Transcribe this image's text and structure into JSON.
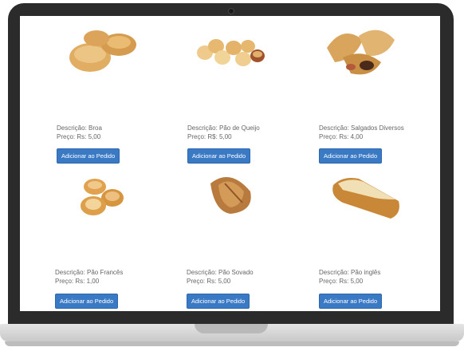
{
  "products": [
    {
      "description": "Descrição: Broa",
      "price": "Preço: Rs: 5,00",
      "button": "Adicionar ao Pedido"
    },
    {
      "description": "Descrição: Pão de Queijo",
      "price": "Preço: R$: 5,00",
      "button": "Adicionar ao Pedido"
    },
    {
      "description": "Descrição: Salgados Diversos",
      "price": "Preço: Rs: 4,00",
      "button": "Adicionar ao Pedido"
    },
    {
      "description": "Descrição: Pão Francês",
      "price": "Preço: Rs: 1,00",
      "button": "Adicionar ao Pedido"
    },
    {
      "description": "Descrição: Pão Sovado",
      "price": "Preço: Rs: 5,00",
      "button": "Adicionar ao Pedido"
    },
    {
      "description": "Descrição: Pão inglês",
      "price": "Preço: Rs: 5,00",
      "button": "Adicionar ao Pedido"
    }
  ],
  "colors": {
    "button": "#3a79c4",
    "bread": "#d9a85a",
    "text": "#666666"
  }
}
